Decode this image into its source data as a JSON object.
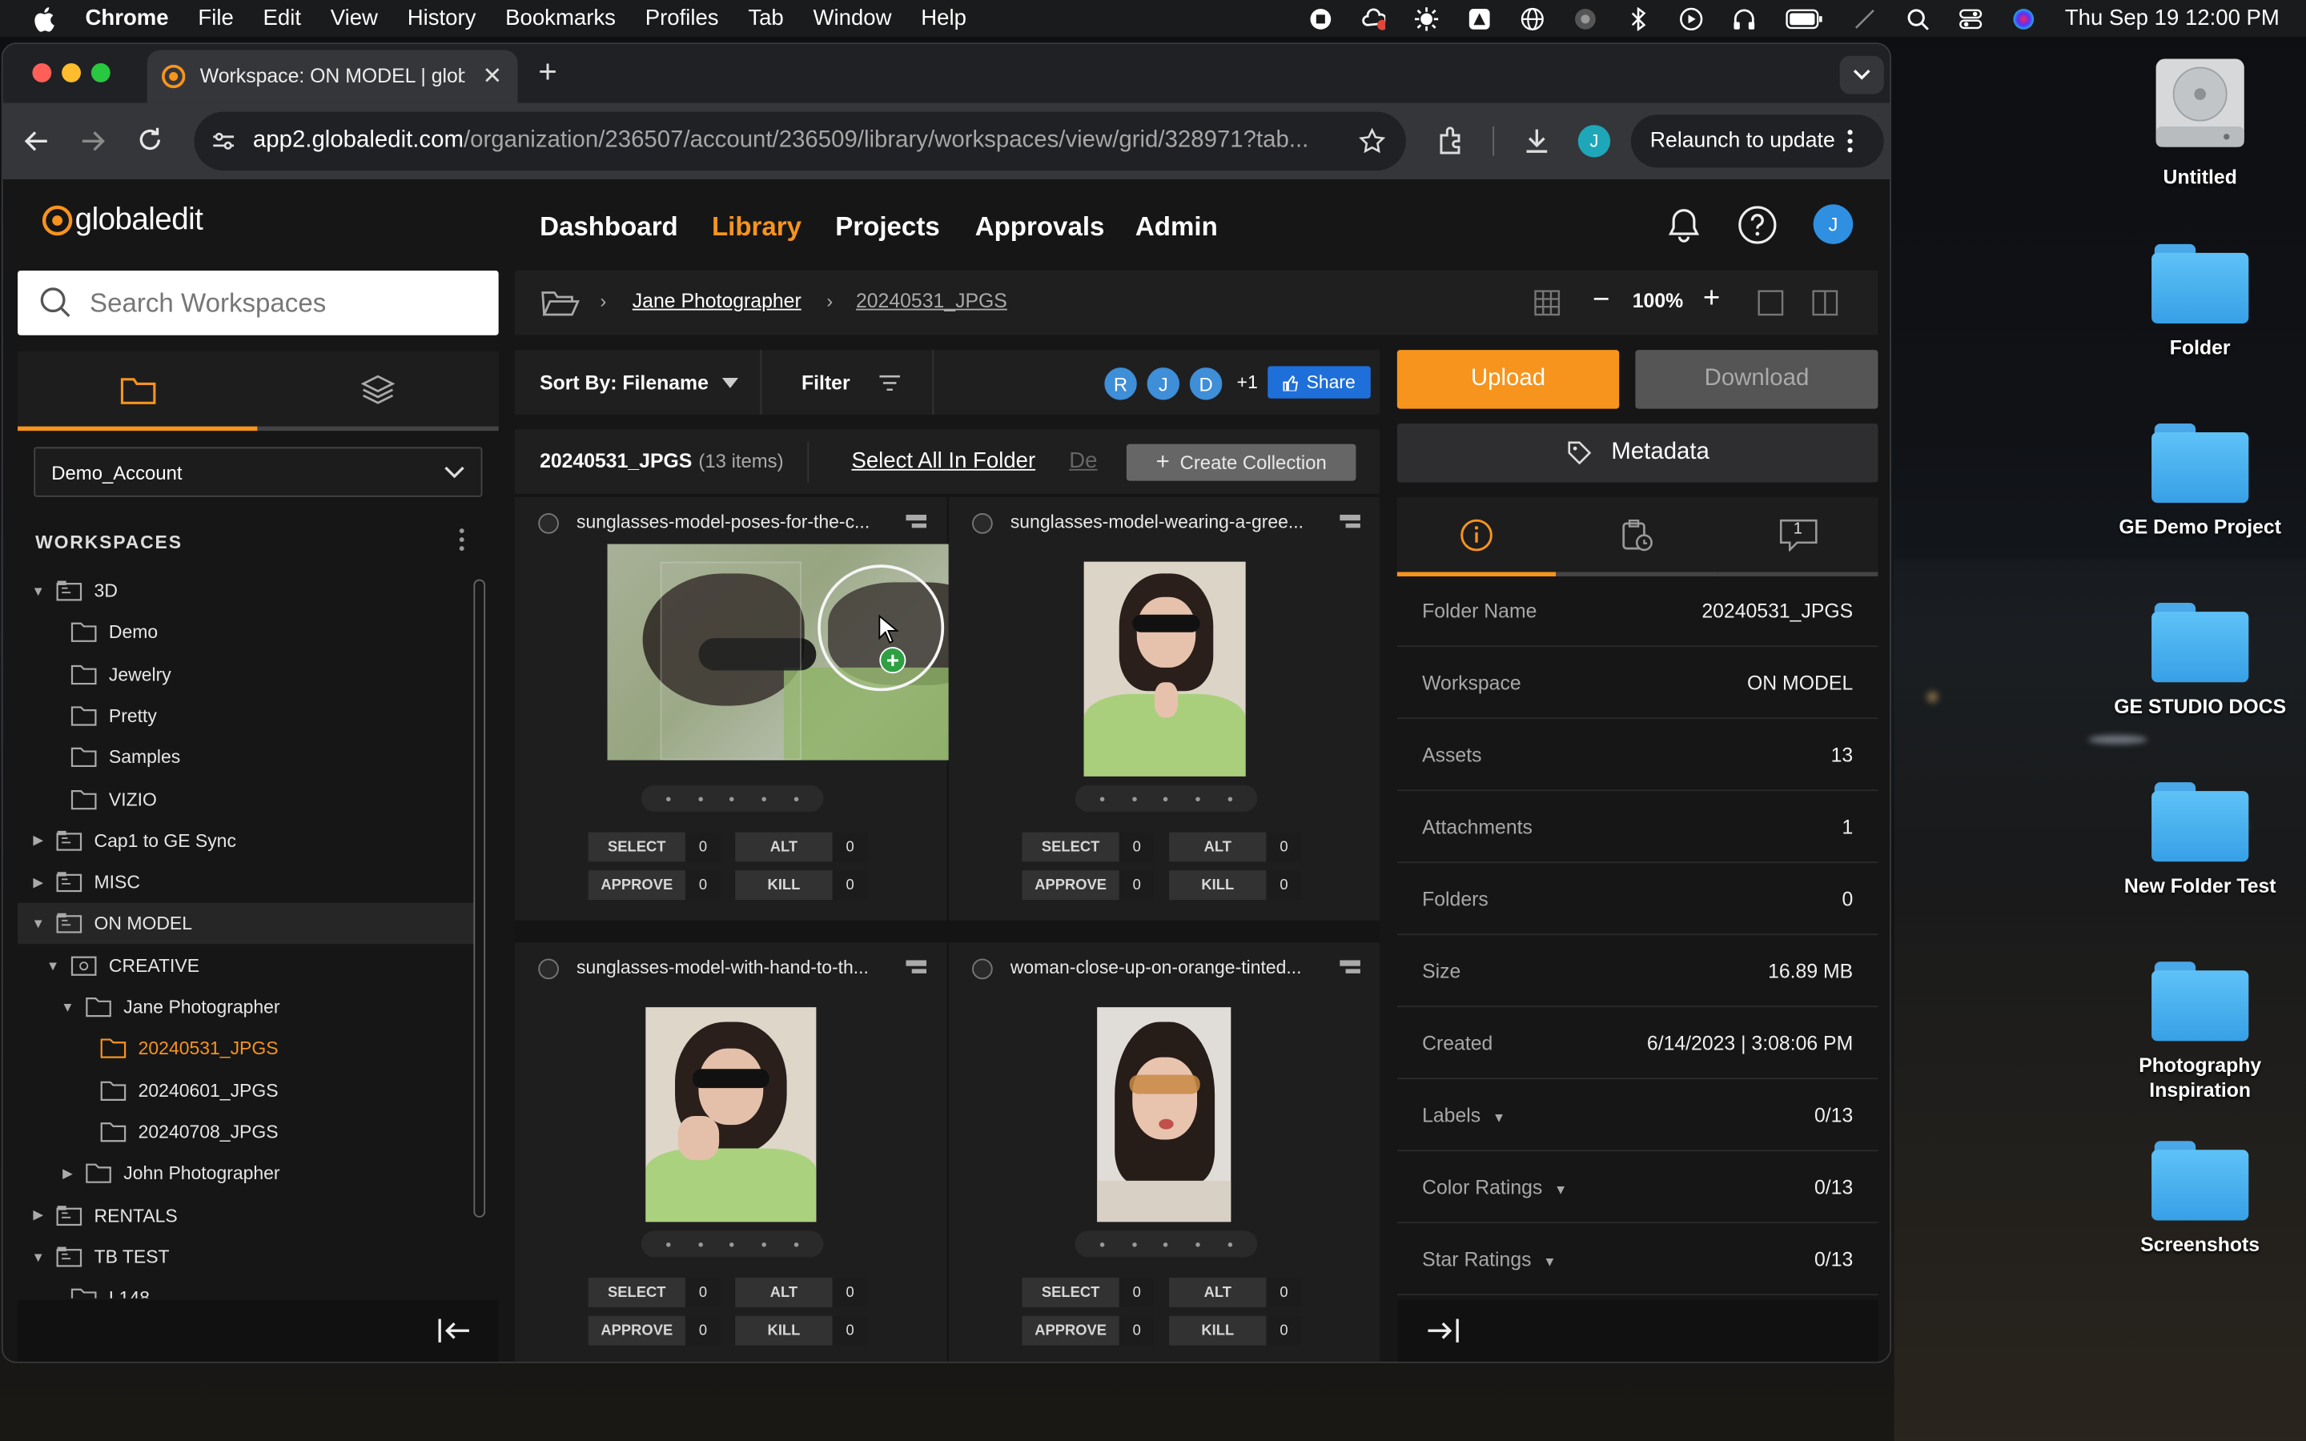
{
  "menubar": {
    "app_name": "Chrome",
    "items": [
      "File",
      "Edit",
      "View",
      "History",
      "Bookmarks",
      "Profiles",
      "Tab",
      "Window",
      "Help"
    ],
    "clock": "Thu Sep 19  12:00 PM"
  },
  "desktop": {
    "icons": [
      {
        "label": "Untitled",
        "type": "drive"
      },
      {
        "label": "Folder",
        "type": "folder"
      },
      {
        "label": "GE Demo Project",
        "type": "folder"
      },
      {
        "label": "GE STUDIO DOCS",
        "type": "folder"
      },
      {
        "label": "New Folder Test",
        "type": "folder"
      },
      {
        "label": "Photography Inspiration",
        "type": "folder"
      },
      {
        "label": "Screenshots",
        "type": "folder"
      }
    ]
  },
  "browser": {
    "tab_title": "Workspace: ON MODEL | glob",
    "url_host": "app2.globaledit.com",
    "url_path": "/organization/236507/account/236509/library/workspaces/view/grid/328971?tab...",
    "profile_initial": "J",
    "relaunch_label": "Relaunch to update"
  },
  "app": {
    "logo": "globaledit",
    "nav": [
      "Dashboard",
      "Library",
      "Projects",
      "Approvals",
      "Admin"
    ],
    "active_nav": "Library",
    "avatar_initial": "J",
    "search_placeholder": "Search Workspaces",
    "account_select": "Demo_Account",
    "workspaces_header": "WORKSPACES",
    "tree": [
      {
        "label": "3D",
        "level": 0,
        "kind": "workspace",
        "expanded": true
      },
      {
        "label": "Demo",
        "level": 1,
        "kind": "folder"
      },
      {
        "label": "Jewelry",
        "level": 1,
        "kind": "folder"
      },
      {
        "label": "Pretty",
        "level": 1,
        "kind": "folder"
      },
      {
        "label": "Samples",
        "level": 1,
        "kind": "folder"
      },
      {
        "label": "VIZIO",
        "level": 1,
        "kind": "folder"
      },
      {
        "label": "Cap1 to GE Sync",
        "level": 0,
        "kind": "workspace",
        "expanded": false
      },
      {
        "label": "MISC",
        "level": 0,
        "kind": "workspace",
        "expanded": false
      },
      {
        "label": "ON MODEL",
        "level": 0,
        "kind": "workspace",
        "expanded": true,
        "selected": true
      },
      {
        "label": "CREATIVE",
        "level": 1,
        "kind": "collection",
        "expanded": true
      },
      {
        "label": "Jane Photographer",
        "level": 2,
        "kind": "folder",
        "expanded": true
      },
      {
        "label": "20240531_JPGS",
        "level": 3,
        "kind": "folder",
        "active": true
      },
      {
        "label": "20240601_JPGS",
        "level": 3,
        "kind": "folder"
      },
      {
        "label": "20240708_JPGS",
        "level": 3,
        "kind": "folder"
      },
      {
        "label": "John Photographer",
        "level": 2,
        "kind": "folder",
        "expanded": false
      },
      {
        "label": "RENTALS",
        "level": 0,
        "kind": "workspace",
        "expanded": false
      },
      {
        "label": "TB TEST",
        "level": 0,
        "kind": "workspace",
        "expanded": true
      },
      {
        "label": "L148",
        "level": 1,
        "kind": "folder"
      }
    ],
    "breadcrumb": [
      "Jane Photographer",
      "20240531_JPGS"
    ],
    "zoom": "100%",
    "sort_label": "Sort By: Filename",
    "filter_label": "Filter",
    "collaborators": [
      "R",
      "J",
      "D"
    ],
    "collab_more": "+1",
    "share_label": "Share",
    "upload_label": "Upload",
    "download_label": "Download",
    "metadata_label": "Metadata",
    "folder_title": "20240531_JPGS",
    "folder_count": "(13 items)",
    "select_all_label": "Select All In Folder",
    "deselect_label": "De",
    "create_collection_label": "Create Collection",
    "attachment_badge": "1",
    "assets": [
      {
        "name": "sunglasses-model-poses-for-the-c...",
        "select": "0",
        "alt": "0",
        "approve": "0",
        "kill": "0"
      },
      {
        "name": "sunglasses-model-wearing-a-gree...",
        "select": "0",
        "alt": "0",
        "approve": "0",
        "kill": "0"
      },
      {
        "name": "sunglasses-model-with-hand-to-th...",
        "select": "0",
        "alt": "0",
        "approve": "0",
        "kill": "0"
      },
      {
        "name": "woman-close-up-on-orange-tinted...",
        "select": "0",
        "alt": "0",
        "approve": "0",
        "kill": "0"
      }
    ],
    "vote_labels": {
      "select": "SELECT",
      "alt": "ALT",
      "approve": "APPROVE",
      "kill": "KILL"
    },
    "details": [
      {
        "k": "Folder Name",
        "v": "20240531_JPGS"
      },
      {
        "k": "Workspace",
        "v": "ON MODEL"
      },
      {
        "k": "Assets",
        "v": "13"
      },
      {
        "k": "Attachments",
        "v": "1"
      },
      {
        "k": "Folders",
        "v": "0"
      },
      {
        "k": "Size",
        "v": "16.89 MB"
      },
      {
        "k": "Created",
        "v": "6/14/2023 | 3:08:06 PM"
      },
      {
        "k": "Labels",
        "v": "0/13",
        "dropdown": true
      },
      {
        "k": "Color Ratings",
        "v": "0/13",
        "dropdown": true
      },
      {
        "k": "Star Ratings",
        "v": "0/13",
        "dropdown": true
      }
    ],
    "colors": {
      "accent": "#f7941d",
      "share": "#1e6fd9",
      "collab": "#3e8ed8"
    }
  }
}
